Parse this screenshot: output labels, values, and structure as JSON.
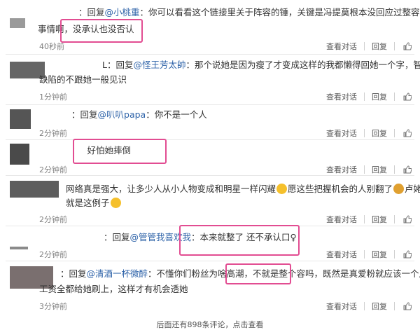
{
  "comments": [
    {
      "prefix": "：回复",
      "mention": "@小桃重",
      "lines": [
        "：你可以看看这个链接里关于阵容的锤，关键是冯提莫根本没回应过整容的",
        "事情啊，没承认也没否认"
      ],
      "time": "40秒前"
    },
    {
      "prefix": "L：回复",
      "mention": "@怪王芳太帥",
      "lines": [
        "：那个说她是因为瘦了才变成这样的我都懒得回她一个字，智商有",
        "缺陷的不跟她一般见识"
      ],
      "time": "1分钟前"
    },
    {
      "prefix": "：回复",
      "mention": "@叭叭papa",
      "lines": [
        "：你不是一个人"
      ],
      "time": "2分钟前"
    },
    {
      "prefix": "：",
      "mention": "",
      "lines": [
        "好怕她摔倒"
      ],
      "time": "2分钟前"
    },
    {
      "prefix": "",
      "mention": "",
      "lines": [
        "网络真是强大，让多少人从小人物变成和明星一样闪耀",
        "愿这些把握机会的人别翻了",
        "卢姥爷",
        "就是这例子"
      ],
      "time": "2分钟前"
    },
    {
      "prefix": "：回复",
      "mention": "@管管我喜欢我",
      "lines": [
        "：本来就整了 还不承认口♀"
      ],
      "time": "2分钟前"
    },
    {
      "prefix": "：回复",
      "mention": "@清酒一杯微醉",
      "lines": [
        "：不懂你们粉丝为啥高潮，不就是整个容吗，既然是真爱粉就应该一个月的",
        "工资全都给她刷上，这样才有机会透她"
      ],
      "time": "3分钟前"
    }
  ],
  "actions": {
    "view": "查看对话",
    "reply": "回复"
  },
  "footer": "后面还有898条评论，点击查看"
}
